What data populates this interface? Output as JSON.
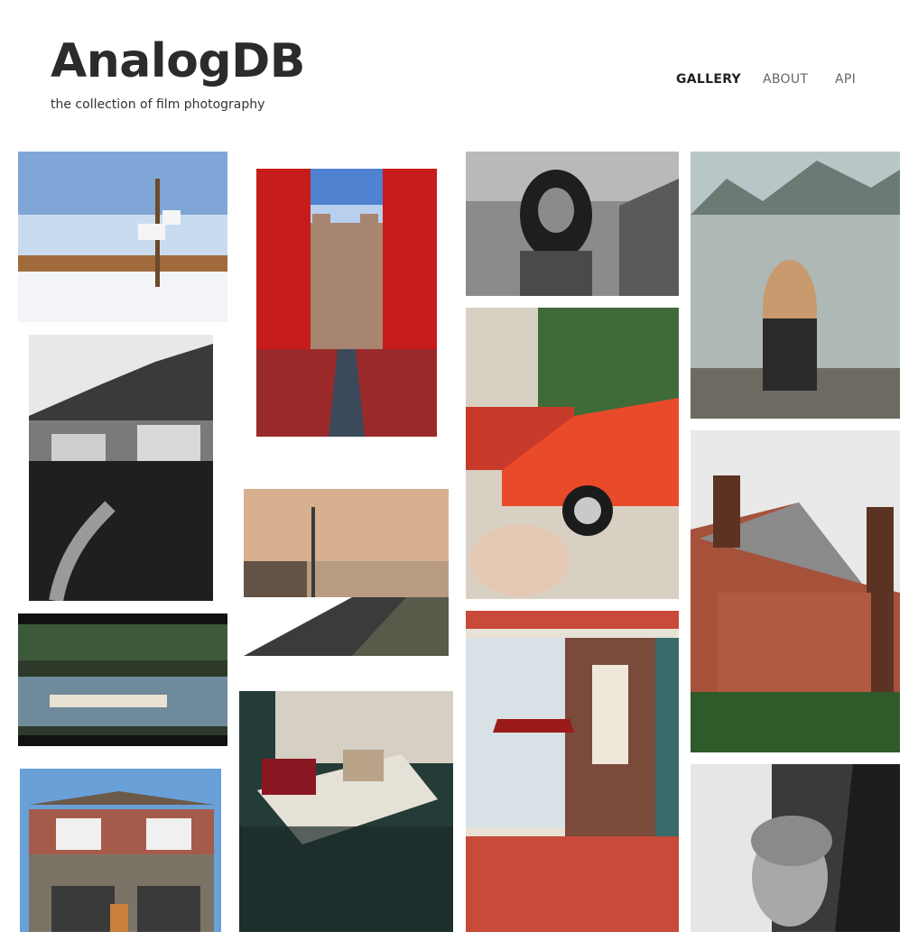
{
  "site": {
    "title": "AnalogDB",
    "tagline": "the collection of film photography"
  },
  "nav": {
    "items": [
      {
        "label": "GALLERY",
        "active": true
      },
      {
        "label": "ABOUT",
        "active": false
      },
      {
        "label": "API",
        "active": false
      }
    ]
  },
  "gallery": {
    "photos": [
      {
        "subject": "basketball hoop in snowy park",
        "colors": [
          "#7fa6d6",
          "#c9dcef",
          "#f2f4f8",
          "#6b4a2a"
        ]
      },
      {
        "subject": "cathedral framed by red foliage",
        "colors": [
          "#4f82d0",
          "#c71c1c",
          "#9a2a2a",
          "#a78570"
        ]
      },
      {
        "subject": "woman on rocky beach (black and white)",
        "colors": [
          "#b9b9b9",
          "#5a5a5a",
          "#1e1e1e",
          "#8b8b8b"
        ]
      },
      {
        "subject": "woman in black swimsuit by mountain lake",
        "colors": [
          "#6b7a73",
          "#aeb8b5",
          "#2b2b2b",
          "#c89a6d"
        ]
      },
      {
        "subject": "mountain town road (black and white)",
        "colors": [
          "#e8e8e8",
          "#3a3a3a",
          "#6e6e6e",
          "#1a1a1a"
        ]
      },
      {
        "subject": "red vintage cars",
        "colors": [
          "#3f6b38",
          "#e84a2a",
          "#d8d1c3",
          "#1b1b1b"
        ]
      },
      {
        "subject": "suburban road at sunset",
        "colors": [
          "#d6b08f",
          "#3b3b3b",
          "#645244",
          "#b79c82"
        ]
      },
      {
        "subject": "brick victorian mansion",
        "colors": [
          "#e9e9e9",
          "#a6523a",
          "#2f5a2a",
          "#5c3323"
        ]
      },
      {
        "subject": "lake through film sprocket holes",
        "colors": [
          "#2d3a2a",
          "#6f8a9a",
          "#e9e2d2",
          "#111111"
        ]
      },
      {
        "subject": "retro diner booth",
        "colors": [
          "#253b38",
          "#e6e1d6",
          "#8a1622",
          "#d5cfc4"
        ]
      },
      {
        "subject": "pizza hut interior",
        "colors": [
          "#c84a3a",
          "#e8e1d5",
          "#3a6a6a",
          "#9b1a1a"
        ]
      },
      {
        "subject": "stone and brick house",
        "colors": [
          "#6aa0d8",
          "#a65a4a",
          "#7b7466",
          "#3a3a3a"
        ]
      },
      {
        "subject": "woman with glasses (black and white)",
        "colors": [
          "#e6e6e6",
          "#3a3a3a",
          "#a8a8a8",
          "#1c1c1c"
        ]
      }
    ]
  }
}
